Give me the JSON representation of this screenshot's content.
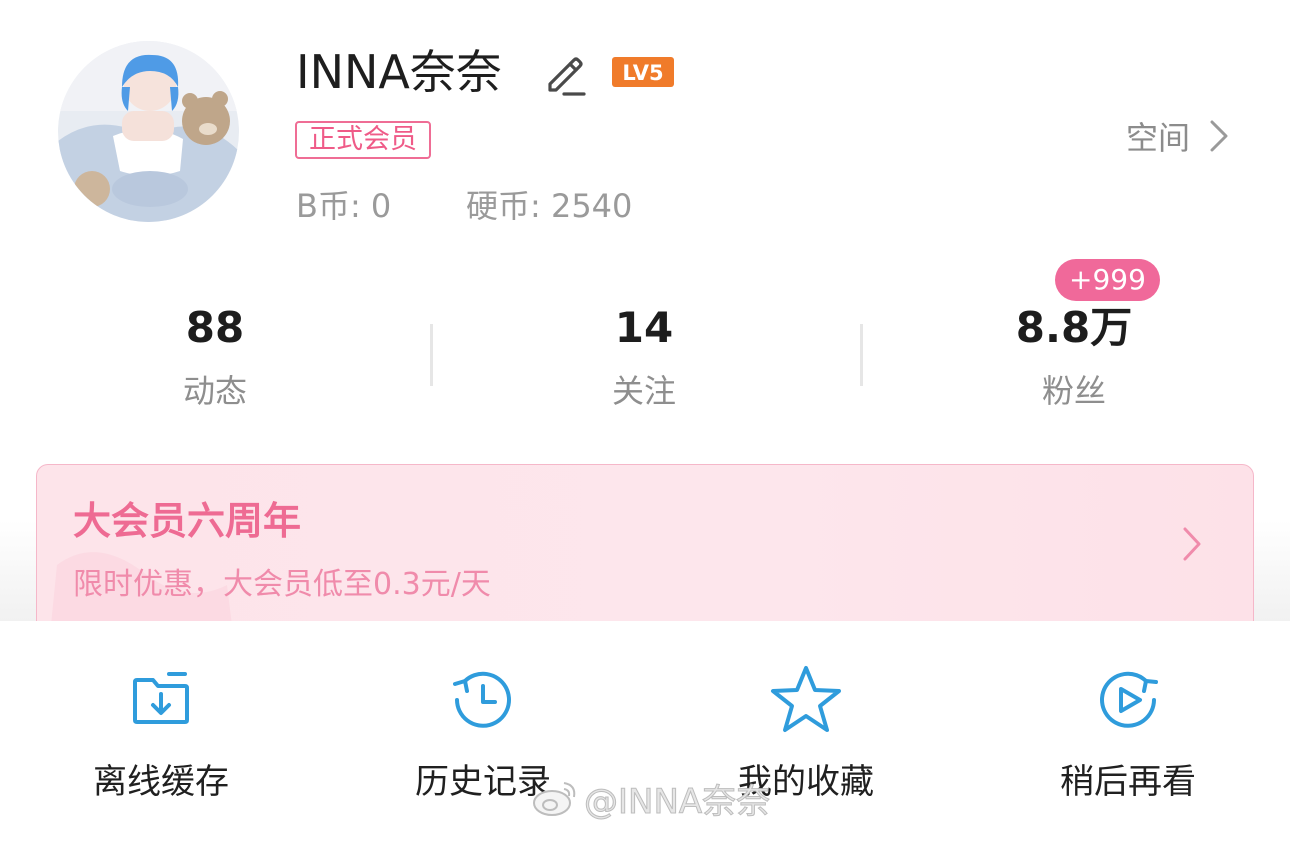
{
  "profile": {
    "username": "INNA奈奈",
    "level": "LV5",
    "member_badge": "正式会员",
    "bcoin": "B币: 0",
    "coin": "硬币: 2540",
    "space_link": "空间"
  },
  "stats": [
    {
      "value": "88",
      "label": "动态"
    },
    {
      "value": "14",
      "label": "关注"
    },
    {
      "value": "8.8万",
      "label": "粉丝",
      "badge": "+999"
    }
  ],
  "promo": {
    "title": "大会员六周年",
    "subtitle": "限时优惠，大会员低至0.3元/天"
  },
  "quick_actions": [
    {
      "label": "离线缓存",
      "icon": "download-folder-icon"
    },
    {
      "label": "历史记录",
      "icon": "history-clock-icon"
    },
    {
      "label": "我的收藏",
      "icon": "star-icon"
    },
    {
      "label": "稍后再看",
      "icon": "watch-later-icon"
    }
  ],
  "watermark": "@INNA奈奈",
  "colors": {
    "accent_pink": "#f0699a",
    "member_pink": "#ef5b88",
    "level_orange": "#f07b2a",
    "icon_blue": "#2f9cdc",
    "muted_text": "#9a9a9a"
  }
}
